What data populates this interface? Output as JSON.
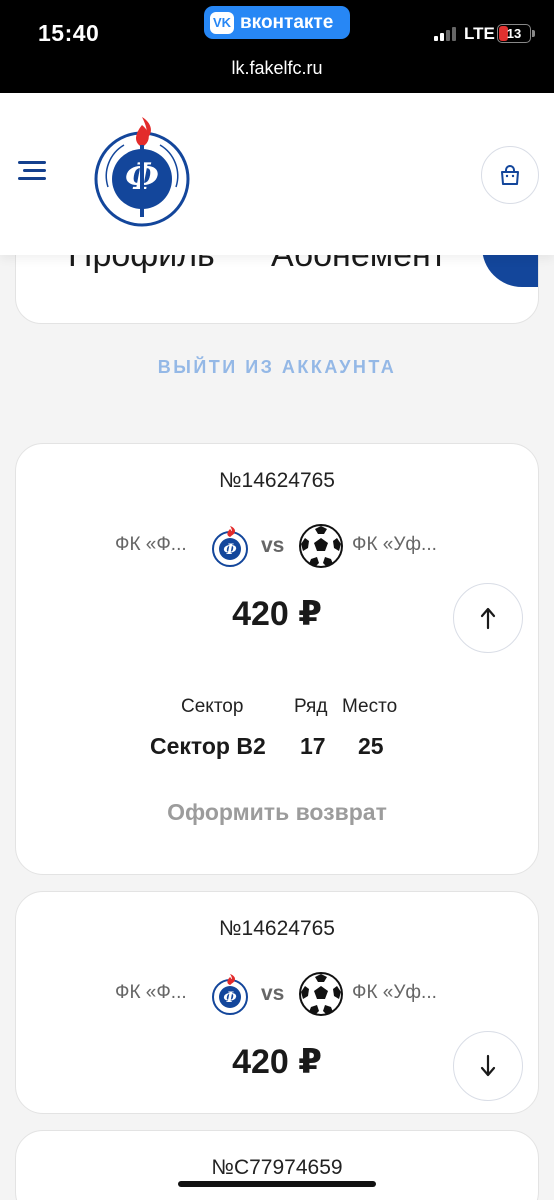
{
  "status_bar": {
    "time": "15:40",
    "app_name": "вконтакте",
    "url": "lk.fakelfc.ru",
    "network": "LTE",
    "battery": "13"
  },
  "header": {
    "menu_icon": "menu-icon",
    "logo_icon": "fakel-crest-logo",
    "cart_icon": "shopping-bag-icon"
  },
  "tabs": [
    "Профиль",
    "Абонемент"
  ],
  "logout_label": "ВЫЙТИ ИЗ АККАУНТА",
  "tickets": [
    {
      "number": "№14624765",
      "home_team": "ФК «Ф...",
      "vs": "vs",
      "away_team": "ФК «Уф...",
      "price": "420 ₽",
      "sector_label": "Сектор",
      "row_label": "Ряд",
      "seat_label": "Место",
      "sector": "Сектор B2",
      "row": "17",
      "seat": "25",
      "refund_label": "Оформить возврат",
      "expanded": true
    },
    {
      "number": "№14624765",
      "home_team": "ФК «Ф...",
      "vs": "vs",
      "away_team": "ФК «Уф...",
      "price": "420 ₽",
      "expanded": false
    },
    {
      "number": "№C77974659"
    }
  ],
  "colors": {
    "brand_blue": "#13469b",
    "brand_red": "#e32b2b",
    "logout_text": "#94b8e6",
    "vk_blue": "#2787f5"
  }
}
